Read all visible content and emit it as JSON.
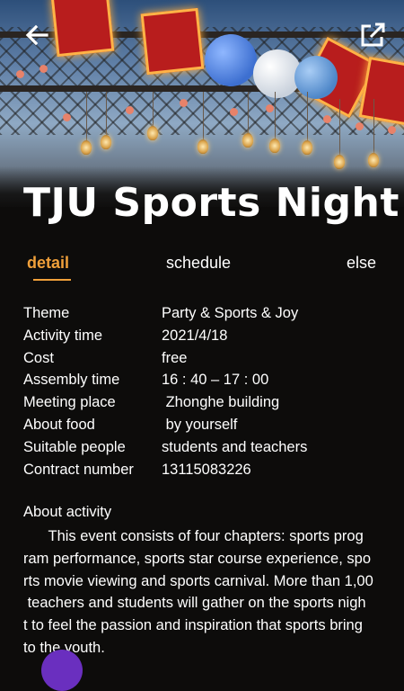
{
  "header": {
    "back_icon": "arrow-left-icon",
    "share_icon": "external-link-icon"
  },
  "hero": {
    "image_subject": "sports night banner with lanterns and balloons"
  },
  "title": "TJU Sports Night",
  "tabs": [
    {
      "label": "detail",
      "active": true
    },
    {
      "label": "schedule",
      "active": false
    },
    {
      "label": "else",
      "active": false
    }
  ],
  "details": [
    {
      "key": "Theme",
      "value": "Party & Sports & Joy"
    },
    {
      "key": "Activity time",
      "value": "2021/4/18"
    },
    {
      "key": "Cost",
      "value": "free"
    },
    {
      "key": "Assembly time",
      "value": "16 : 40 – 17 : 00"
    },
    {
      "key": "Meeting place",
      "value": " Zhonghe building"
    },
    {
      "key": "About food",
      "value": " by yourself"
    },
    {
      "key": "Suitable people",
      "value": "students and teachers"
    },
    {
      "key": "Contract number",
      "value": "13115083226"
    }
  ],
  "about": {
    "title": "About activity",
    "lines": [
      "      This event consists of four chapters: sports prog",
      "ram performance, sports star course experience, spo",
      "rts movie viewing and sports carnival. More than 1,00",
      " teachers and students will gather on the sports nigh",
      "t to feel the passion and inspiration that sports bring",
      "to the youth."
    ]
  },
  "colors": {
    "accent": "#f0a03a",
    "background": "#0d0c0b"
  }
}
